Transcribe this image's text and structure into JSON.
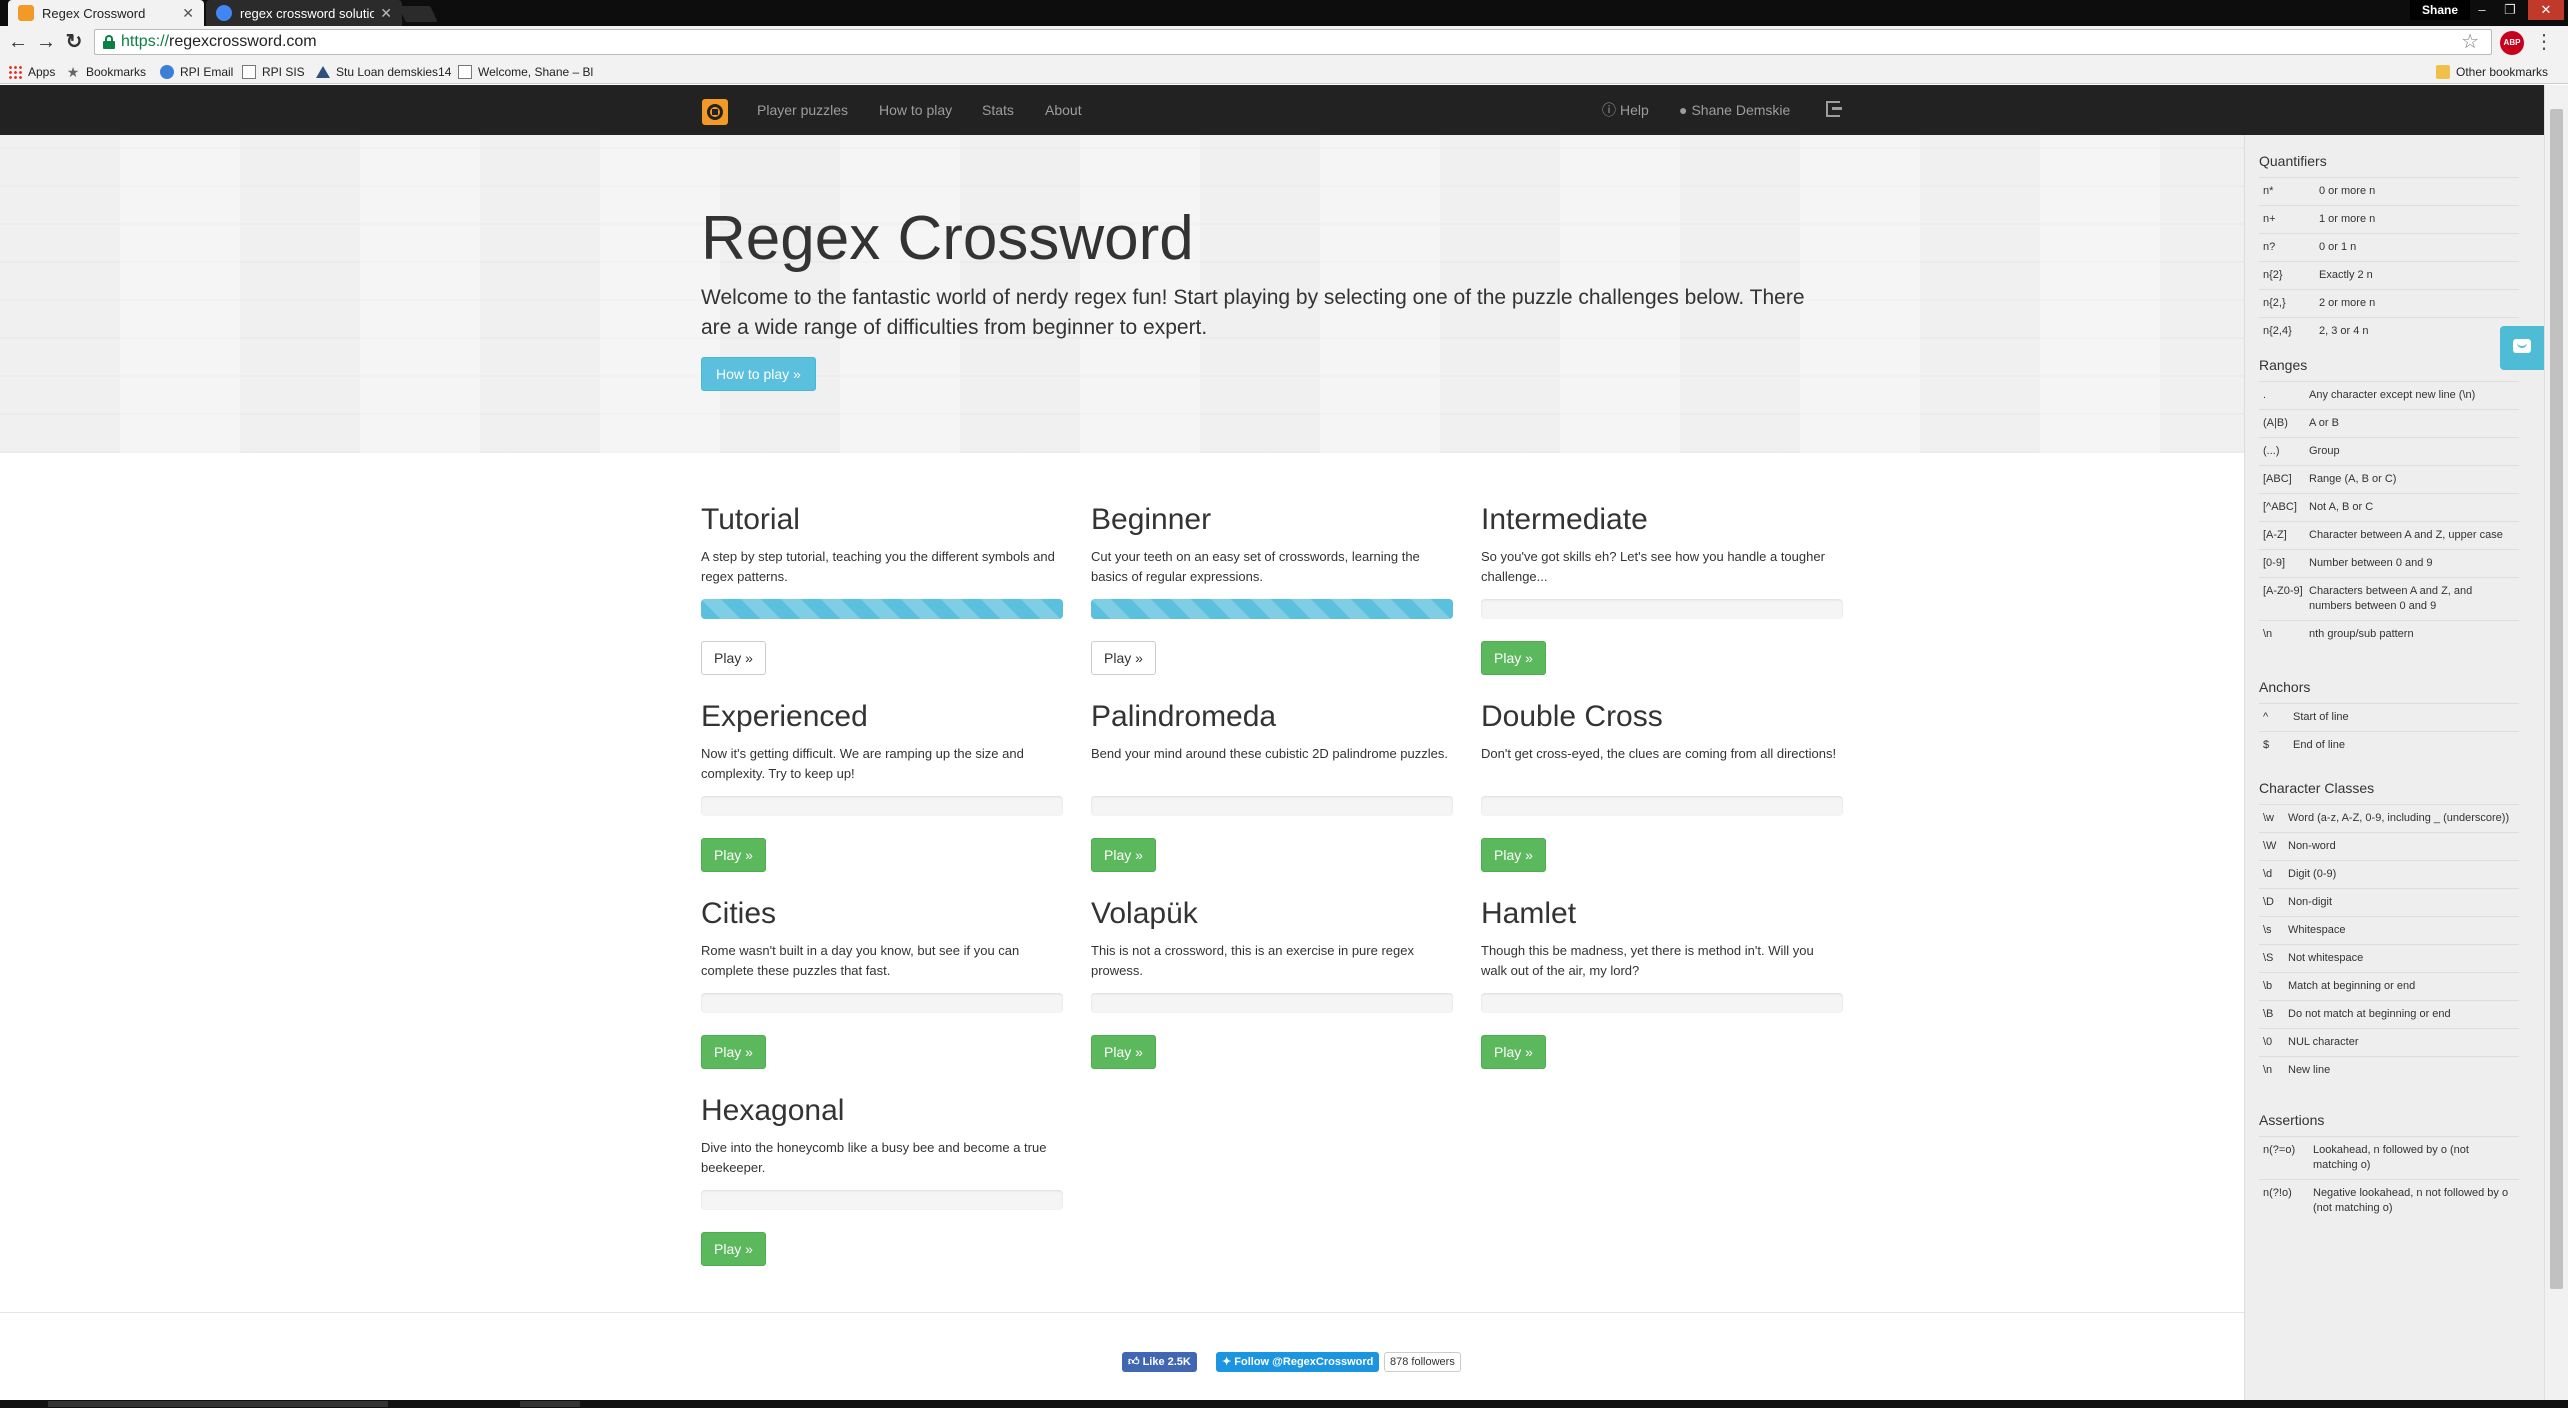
{
  "browser": {
    "tabs": [
      {
        "title": "Regex Crossword",
        "favicon_color": "#f39a26",
        "active": true
      },
      {
        "title": "regex crossword solution",
        "favicon_color": "#4285f4",
        "active": false
      }
    ],
    "profile": "Shane",
    "url_scheme": "https://",
    "url_host": "regexcrossword.com",
    "bookmarks": [
      {
        "label": "Apps",
        "icon": "apps-grid-icon"
      },
      {
        "label": "Bookmarks",
        "icon": "star-icon"
      },
      {
        "label": "RPI Email",
        "icon": "globe-icon"
      },
      {
        "label": "RPI SIS",
        "icon": "document-icon"
      },
      {
        "label": "Stu Loan demskies14",
        "icon": "mountain-icon"
      },
      {
        "label": "Welcome, Shane – Bl",
        "icon": "document-icon"
      }
    ],
    "other_bookmarks": "Other bookmarks",
    "abp_label": "ABP"
  },
  "nav": {
    "links": [
      "Player puzzles",
      "How to play",
      "Stats",
      "About"
    ],
    "help": "Help",
    "user": "Shane Demskie"
  },
  "hero": {
    "title": "Regex Crossword",
    "lead": "Welcome to the fantastic world of nerdy regex fun! Start playing by selecting one of the puzzle challenges below. There are a wide range of difficulties from beginner to expert.",
    "button": "How to play »"
  },
  "puzzles": [
    {
      "title": "Tutorial",
      "desc": "A step by step tutorial, teaching you the different symbols and regex patterns.",
      "progress": 1.0,
      "button": "Play »",
      "completed": true
    },
    {
      "title": "Beginner",
      "desc": "Cut your teeth on an easy set of crosswords, learning the basics of regular expressions.",
      "progress": 1.0,
      "button": "Play »",
      "completed": true
    },
    {
      "title": "Intermediate",
      "desc": "So you've got skills eh? Let's see how you handle a tougher challenge...",
      "progress": 0,
      "button": "Play »",
      "completed": false
    },
    {
      "title": "Experienced",
      "desc": "Now it's getting difficult. We are ramping up the size and complexity. Try to keep up!",
      "progress": 0,
      "button": "Play »",
      "completed": false
    },
    {
      "title": "Palindromeda",
      "desc": "Bend your mind around these cubistic 2D palindrome puzzles.",
      "progress": 0,
      "button": "Play »",
      "completed": false
    },
    {
      "title": "Double Cross",
      "desc": "Don't get cross-eyed, the clues are coming from all directions!",
      "progress": 0,
      "button": "Play »",
      "completed": false
    },
    {
      "title": "Cities",
      "desc": "Rome wasn't built in a day you know, but see if you can complete these puzzles that fast.",
      "progress": 0,
      "button": "Play »",
      "completed": false
    },
    {
      "title": "Volapük",
      "desc": "This is not a crossword, this is an exercise in pure regex prowess.",
      "progress": 0,
      "button": "Play »",
      "completed": false
    },
    {
      "title": "Hamlet",
      "desc": "Though this be madness, yet there is method in't. Will you walk out of the air, my lord?",
      "progress": 0,
      "button": "Play »",
      "completed": false
    },
    {
      "title": "Hexagonal",
      "desc": "Dive into the honeycomb like a busy bee and become a true beekeeper.",
      "progress": 0,
      "button": "Play »",
      "completed": false
    }
  ],
  "footer": {
    "like": "Like 2.5K",
    "follow": "Follow @RegexCrossword",
    "followers": "878 followers"
  },
  "cheatsheet": [
    {
      "title": "Quantifiers",
      "rows": [
        {
          "k": "n*",
          "v": "0 or more n"
        },
        {
          "k": "n+",
          "v": "1 or more n"
        },
        {
          "k": "n?",
          "v": "0 or 1 n"
        },
        {
          "k": "n{2}",
          "v": "Exactly 2 n"
        },
        {
          "k": "n{2,}",
          "v": "2 or more n"
        },
        {
          "k": "n{2,4}",
          "v": "2, 3 or 4 n"
        }
      ]
    },
    {
      "title": "Ranges",
      "rows": [
        {
          "k": ".",
          "v": "Any character except new line (\\n)"
        },
        {
          "k": "(A|B)",
          "v": "A or B"
        },
        {
          "k": "(...)",
          "v": "Group"
        },
        {
          "k": "[ABC]",
          "v": "Range (A, B or C)"
        },
        {
          "k": "[^ABC]",
          "v": "Not A, B or C"
        },
        {
          "k": "[A-Z]",
          "v": "Character between A and Z, upper case"
        },
        {
          "k": "[0-9]",
          "v": "Number between 0 and 9"
        },
        {
          "k": "[A-Z0-9]",
          "v": "Characters between A and Z, and numbers between 0 and 9"
        },
        {
          "k": "\\n",
          "v": "nth group/sub pattern"
        }
      ]
    },
    {
      "title": "Anchors",
      "rows": [
        {
          "k": "^",
          "v": "Start of line"
        },
        {
          "k": "$",
          "v": "End of line"
        }
      ]
    },
    {
      "title": "Character Classes",
      "rows": [
        {
          "k": "\\w",
          "v": "Word (a-z, A-Z, 0-9, including _ (underscore))"
        },
        {
          "k": "\\W",
          "v": "Non-word"
        },
        {
          "k": "\\d",
          "v": "Digit (0-9)"
        },
        {
          "k": "\\D",
          "v": "Non-digit"
        },
        {
          "k": "\\s",
          "v": "Whitespace"
        },
        {
          "k": "\\S",
          "v": "Not whitespace"
        },
        {
          "k": "\\b",
          "v": "Match at beginning or end"
        },
        {
          "k": "\\B",
          "v": "Do not match at beginning or end"
        },
        {
          "k": "\\0",
          "v": "NUL character"
        },
        {
          "k": "\\n",
          "v": "New line"
        }
      ]
    },
    {
      "title": "Assertions",
      "rows": [
        {
          "k": "n(?=o)",
          "v": "Lookahead, n followed by o (not matching o)"
        },
        {
          "k": "n(?!o)",
          "v": "Negative lookahead, n not followed by o (not matching o)"
        }
      ]
    }
  ]
}
